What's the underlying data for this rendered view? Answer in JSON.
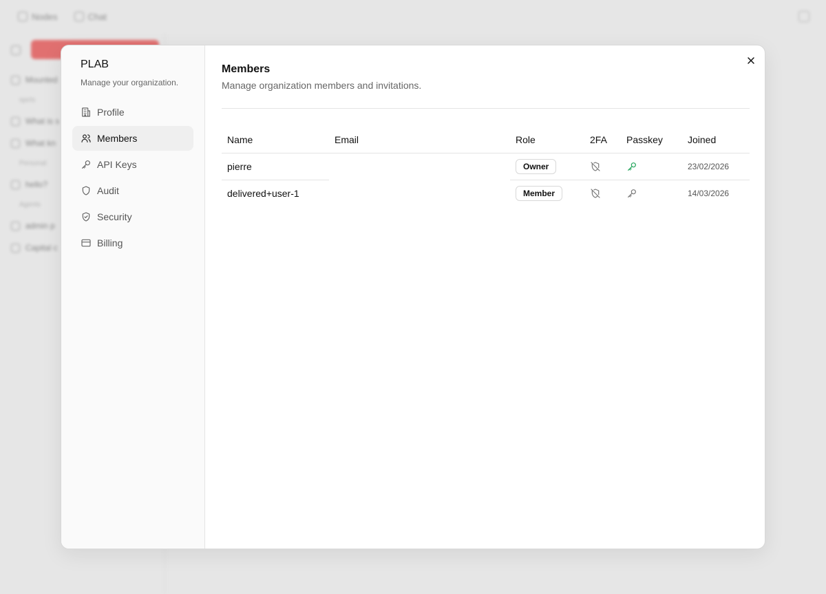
{
  "background": {
    "topbar": {
      "items": [
        "Nodes",
        "Chat"
      ]
    },
    "sidebar": {
      "rows": [
        {
          "kind": "item",
          "label": "Mounted"
        },
        {
          "kind": "head",
          "label": "spcts"
        },
        {
          "kind": "item",
          "label": "What is s"
        },
        {
          "kind": "item",
          "label": "What kn"
        },
        {
          "kind": "head",
          "label": "Personal"
        },
        {
          "kind": "item",
          "label": "hello?"
        },
        {
          "kind": "head",
          "label": "Agents"
        },
        {
          "kind": "item",
          "label": "admin p"
        },
        {
          "kind": "item",
          "label": "Capital c"
        }
      ]
    }
  },
  "org": {
    "name": "PLAB",
    "subtitle": "Manage your organization."
  },
  "nav": [
    {
      "id": "profile",
      "label": "Profile",
      "icon": "building-icon",
      "active": false
    },
    {
      "id": "members",
      "label": "Members",
      "icon": "users-icon",
      "active": true
    },
    {
      "id": "api-keys",
      "label": "API Keys",
      "icon": "key-icon",
      "active": false
    },
    {
      "id": "audit",
      "label": "Audit",
      "icon": "shield-icon",
      "active": false
    },
    {
      "id": "security",
      "label": "Security",
      "icon": "shield-check-icon",
      "active": false
    },
    {
      "id": "billing",
      "label": "Billing",
      "icon": "credit-card-icon",
      "active": false
    }
  ],
  "main": {
    "title": "Members",
    "subtitle": "Manage organization members and invitations."
  },
  "table": {
    "columns": [
      "Name",
      "Email",
      "Role",
      "2FA",
      "Passkey",
      "Joined"
    ],
    "rows": [
      {
        "name": "pierre",
        "email": "",
        "role": "Owner",
        "twofa": "shield-off-icon",
        "passkey": "key-icon",
        "passkey_active": true,
        "joined": "23/02/2026"
      },
      {
        "name": "delivered+user-1",
        "email": "",
        "role": "Member",
        "twofa": "shield-off-icon",
        "passkey": "key-icon",
        "passkey_active": false,
        "joined": "14/03/2026"
      }
    ]
  },
  "colors": {
    "accent_green": "#22a55b",
    "icon_gray": "#777777",
    "brand_red": "#dd1111"
  }
}
